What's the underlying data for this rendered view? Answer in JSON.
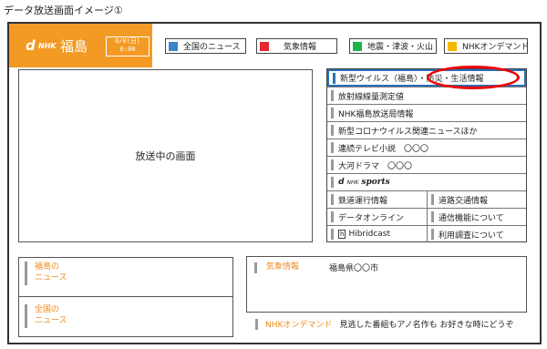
{
  "page_title": "データ放送画面イメージ①",
  "logo": {
    "d": "d",
    "nhk": "NHK",
    "place": "福島",
    "clock_top": "0/0(日)",
    "clock_bottom": "0:00"
  },
  "top_tabs": [
    {
      "label": "全国のニュース",
      "color": "#3a84c9"
    },
    {
      "label": "気象情報",
      "color": "#e8262c"
    },
    {
      "label": "地震・津波・火山",
      "color": "#1db24a"
    },
    {
      "label": "NHKオンデマンド",
      "color": "#f5b800"
    }
  ],
  "screen": {
    "label": "放送中の画面"
  },
  "menu": {
    "items": [
      "新型ウイルス（福島）・防災・生活情報",
      "放射線線量測定値",
      "NHK福島放送局情報",
      "新型コロナウイルス関連ニュースほか",
      "連続テレビ小説　〇〇〇",
      "大河ドラマ　〇〇〇"
    ],
    "sports": {
      "d": "d",
      "nhk": "NHK",
      "word": "sports"
    },
    "grid": [
      [
        "鉄道運行情報",
        "道路交通情報"
      ],
      [
        "データオンライン",
        "通信機能について"
      ]
    ],
    "last_row": {
      "h_icon": "h",
      "left": "Hibridcast",
      "right": "利用調査について"
    }
  },
  "panels": {
    "fukushima_news": [
      "福島の",
      "ニュース"
    ],
    "national_news": [
      "全国の",
      "ニュース"
    ],
    "weather_label": "気象情報",
    "weather_value": "福島県〇〇市",
    "ondemand_label": "NHKオンデマンド",
    "ondemand_text": "見逃した番組もアノ名作も お好きな時にどうぞ"
  },
  "colors": {
    "accent_orange": "#f39a25",
    "highlight_red": "#e00000",
    "selected_blue": "#2b6fb5"
  }
}
